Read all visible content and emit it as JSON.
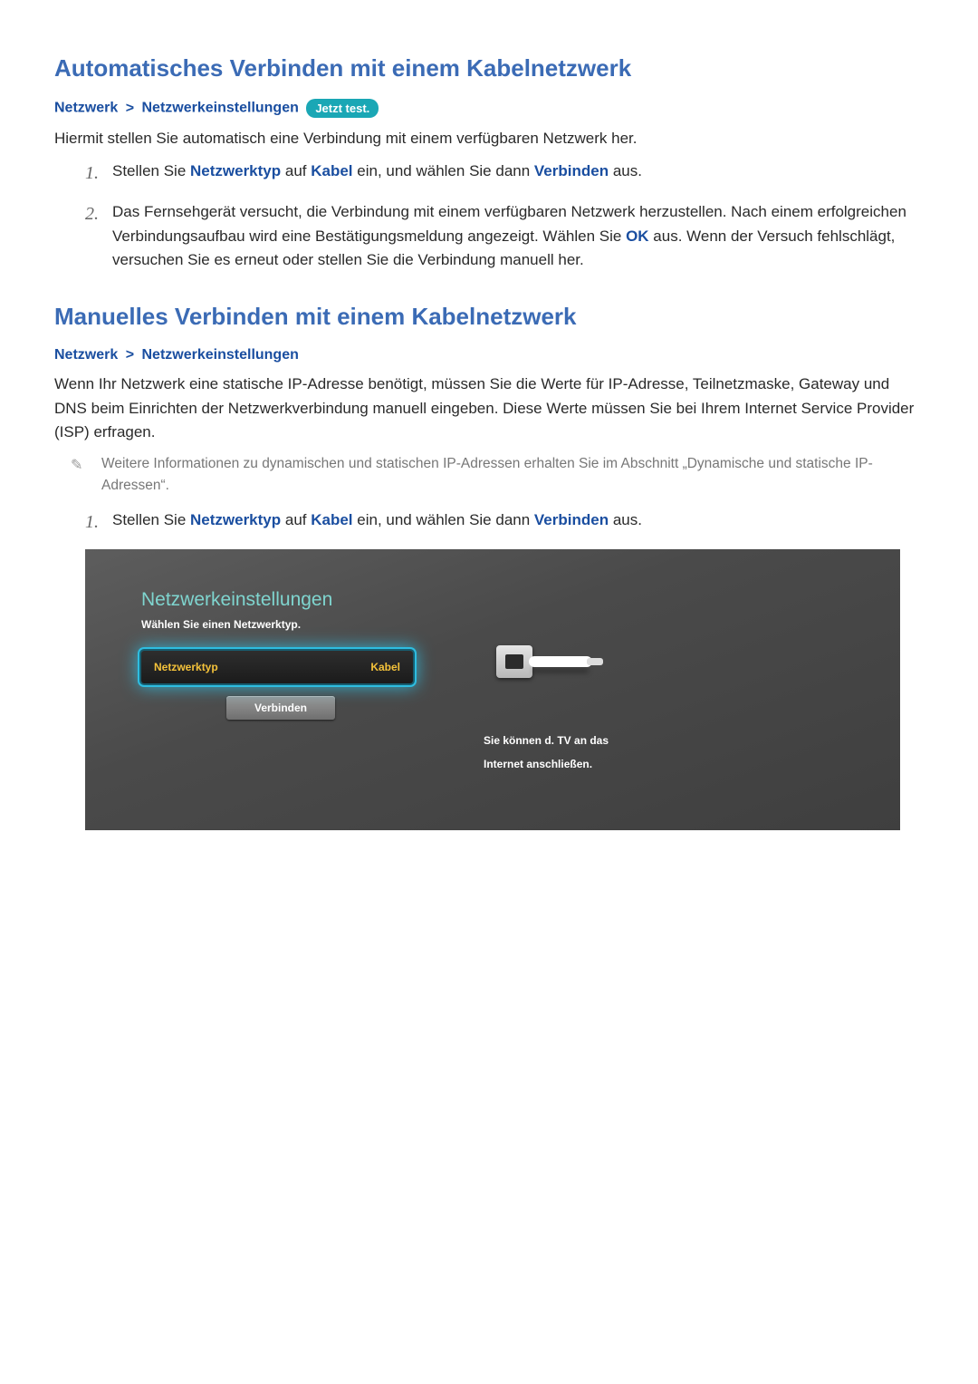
{
  "section1": {
    "heading": "Automatisches Verbinden mit einem Kabelnetzwerk",
    "breadcrumb": {
      "a": "Netzwerk",
      "sep": ">",
      "b": "Netzwerkeinstellungen",
      "pill": "Jetzt test."
    },
    "intro": "Hiermit stellen Sie automatisch eine Verbindung mit einem verfügbaren Netzwerk her.",
    "steps": {
      "1": {
        "num": "1.",
        "pre": "Stellen Sie ",
        "kw1": "Netzwerktyp",
        "mid1": " auf ",
        "kw2": "Kabel",
        "mid2": " ein, und wählen Sie dann ",
        "kw3": "Verbinden",
        "post": " aus."
      },
      "2": {
        "num": "2.",
        "pre": "Das Fernsehgerät versucht, die Verbindung mit einem verfügbaren Netzwerk herzustellen. Nach einem erfolgreichen Verbindungsaufbau wird eine Bestätigungsmeldung angezeigt. Wählen Sie ",
        "kw1": "OK",
        "post": " aus. Wenn der Versuch fehlschlägt, versuchen Sie es erneut oder stellen Sie die Verbindung manuell her."
      }
    }
  },
  "section2": {
    "heading": "Manuelles Verbinden mit einem Kabelnetzwerk",
    "breadcrumb": {
      "a": "Netzwerk",
      "sep": ">",
      "b": "Netzwerkeinstellungen"
    },
    "intro": "Wenn Ihr Netzwerk eine statische IP-Adresse benötigt, müssen Sie die Werte für IP-Adresse, Teilnetzmaske, Gateway und DNS beim Einrichten der Netzwerkverbindung manuell eingeben. Diese Werte müssen Sie bei Ihrem Internet Service Provider (ISP) erfragen.",
    "note": "Weitere Informationen zu dynamischen und statischen IP-Adressen erhalten Sie im Abschnitt „Dynamische und statische IP-Adressen“.",
    "steps": {
      "1": {
        "num": "1.",
        "pre": "Stellen Sie ",
        "kw1": "Netzwerktyp",
        "mid1": " auf ",
        "kw2": "Kabel",
        "mid2": " ein, und wählen Sie dann ",
        "kw3": "Verbinden",
        "post": " aus."
      }
    }
  },
  "tvshot": {
    "title": "Netzwerkeinstellungen",
    "sub": "Wählen Sie einen Netzwerktyp.",
    "row_label": "Netzwerktyp",
    "row_value": "Kabel",
    "connect": "Verbinden",
    "right_line1": "Sie können d. TV an das",
    "right_line2": "Internet anschließen."
  }
}
